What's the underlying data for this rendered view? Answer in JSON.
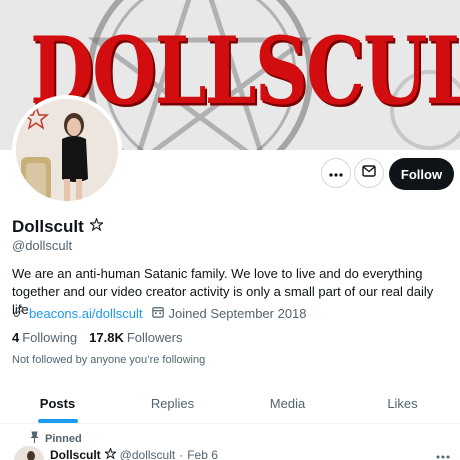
{
  "banner": {
    "text": "DOLLSCULT",
    "accent_color": "#d10d10"
  },
  "profile": {
    "display_name": "Dollscult",
    "handle": "@dollscult",
    "bio": "We are an anti-human Satanic family. We love to live and do everything together and our video creator activity is only a small part of our real daily life.",
    "website": "beacons.ai/dollscult",
    "joined": "Joined September 2018",
    "following_count": "4",
    "following_label": "Following",
    "followers_count": "17.8K",
    "followers_label": "Followers",
    "not_followed_text": "Not followed by anyone you’re following"
  },
  "actions": {
    "more_icon": "more-dots-icon",
    "mail_icon": "mail-icon",
    "follow_label": "Follow"
  },
  "tabs": [
    {
      "label": "Posts",
      "active": true
    },
    {
      "label": "Replies",
      "active": false
    },
    {
      "label": "Media",
      "active": false
    },
    {
      "label": "Likes",
      "active": false
    }
  ],
  "pinned_post": {
    "pinned_label": "Pinned",
    "author": "Dollscult",
    "handle": "@dollscult",
    "separator": "·",
    "date": "Feb 6"
  },
  "colors": {
    "link": "#1d9bf0",
    "text": "#0f1419",
    "muted": "#536471"
  }
}
